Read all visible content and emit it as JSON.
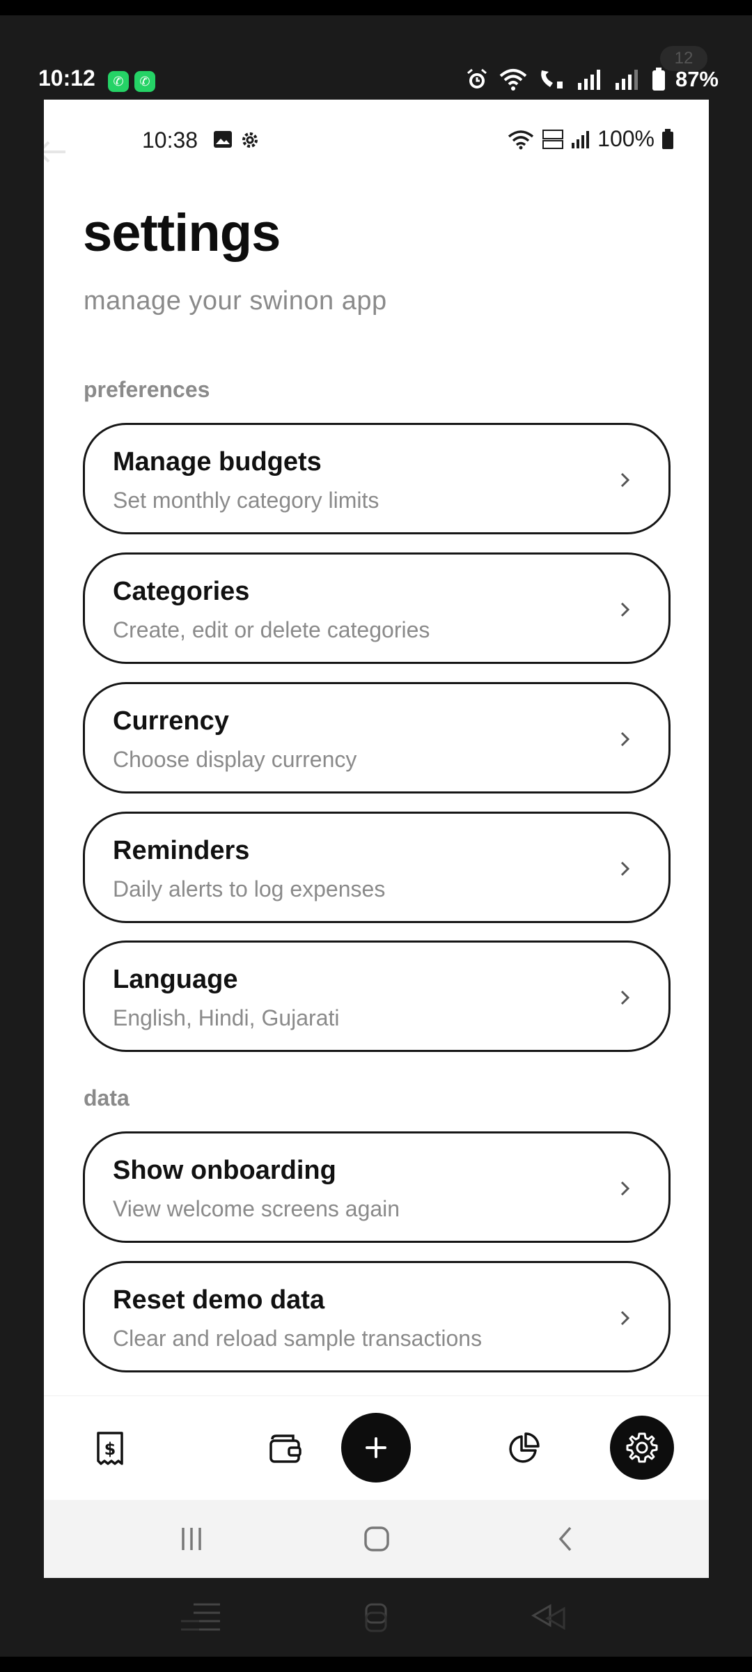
{
  "outer_status": {
    "time": "10:12",
    "notification_count": "12",
    "battery": "87%",
    "app_icons": [
      "whatsapp-icon",
      "whatsapp-icon"
    ],
    "status_icons": [
      "alarm-icon",
      "wifi-icon",
      "wifi-calling-icon",
      "signal-icon",
      "signal-icon",
      "battery-icon"
    ]
  },
  "inner_status": {
    "time": "10:38",
    "battery": "100%",
    "status_icons": [
      "image-icon",
      "gear-icon",
      "wifi-icon",
      "volte-icon",
      "signal-icon",
      "battery-icon"
    ]
  },
  "header": {
    "title": "settings",
    "subtitle": "manage your swinon app"
  },
  "sections": [
    {
      "label": "preferences",
      "items": [
        {
          "title": "Manage budgets",
          "subtitle": "Set monthly category limits"
        },
        {
          "title": "Categories",
          "subtitle": "Create, edit or delete categories"
        },
        {
          "title": "Currency",
          "subtitle": "Choose display currency"
        },
        {
          "title": "Reminders",
          "subtitle": "Daily alerts to log expenses"
        },
        {
          "title": "Language",
          "subtitle": "English, Hindi, Gujarati"
        }
      ]
    },
    {
      "label": "data",
      "items": [
        {
          "title": "Show onboarding",
          "subtitle": "View welcome screens again"
        },
        {
          "title": "Reset demo data",
          "subtitle": "Clear and reload sample transactions"
        }
      ]
    }
  ],
  "tabbar": {
    "tabs": [
      "receipt-icon",
      "wallet-icon",
      "plus-icon",
      "pie-chart-icon",
      "gear-icon"
    ],
    "active": "gear-icon"
  },
  "colors": {
    "accent": "#0d0d0d",
    "muted_text": "#8a8a8a",
    "whatsapp": "#25d366"
  }
}
